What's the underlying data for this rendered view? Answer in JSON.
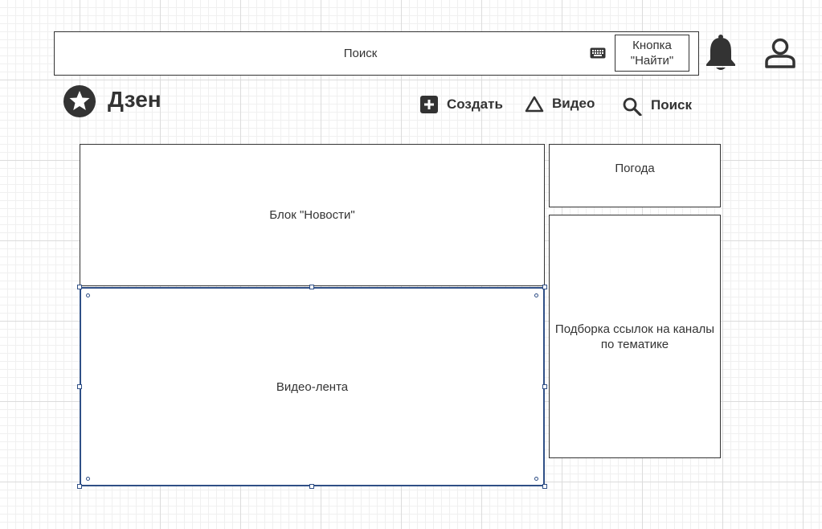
{
  "search_bar": {
    "placeholder": "Поиск",
    "find_button_label": "Кнопка\n\"Найти\""
  },
  "logo": {
    "title": "Дзен"
  },
  "nav": {
    "create": "Создать",
    "video": "Видео",
    "search": "Поиск"
  },
  "blocks": {
    "news": "Блок \"Новости\"",
    "video_feed": "Видео-лента",
    "weather": "Погода",
    "channel_links": "Подборка ссылок на каналы по тематике"
  },
  "icons": {
    "keyboard": "keyboard-icon",
    "bell": "bell-icon",
    "user": "user-icon",
    "logo": "star-icon",
    "create": "plus-icon",
    "video": "triangle-icon",
    "search": "magnifier-icon"
  },
  "colors": {
    "ink": "#333333",
    "selection": "#2f4f86",
    "grid": "#dcdcdc"
  }
}
